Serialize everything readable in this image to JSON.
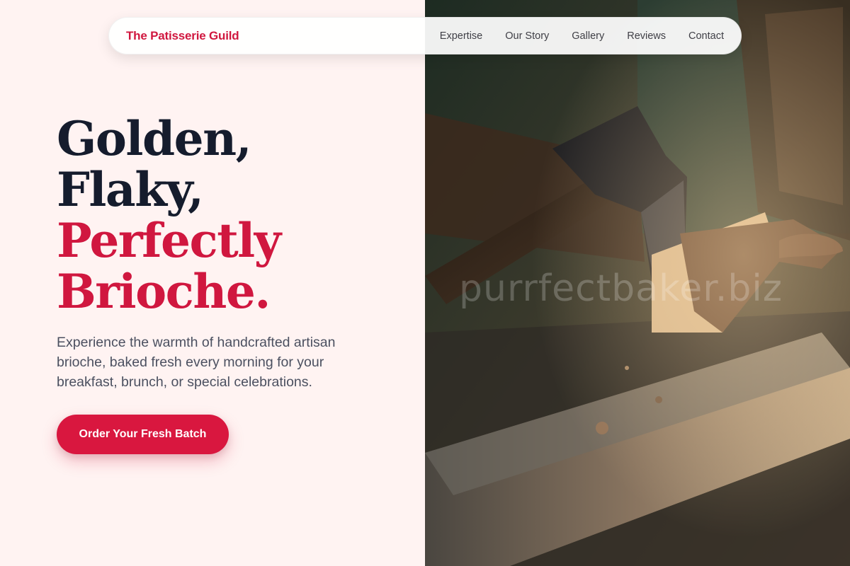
{
  "brand": {
    "name": "The Patisserie Guild"
  },
  "nav": {
    "items": [
      "Expertise",
      "Our Story",
      "Gallery",
      "Reviews",
      "Contact"
    ]
  },
  "hero": {
    "title_line1": "Golden,",
    "title_line2": "Flaky,",
    "title_line3": "Perfectly",
    "title_line4": "Brioche.",
    "subtitle": "Experience the warmth of handcrafted artisan brioche, baked fresh every morning for your breakfast, brunch, or special celebrations.",
    "cta_label": "Order Your Fresh Batch"
  },
  "image": {
    "watermark": "purrfectbaker.biz"
  },
  "colors": {
    "accent": "#d0173f",
    "heading": "#151c2d",
    "background": "#fff3f2"
  }
}
